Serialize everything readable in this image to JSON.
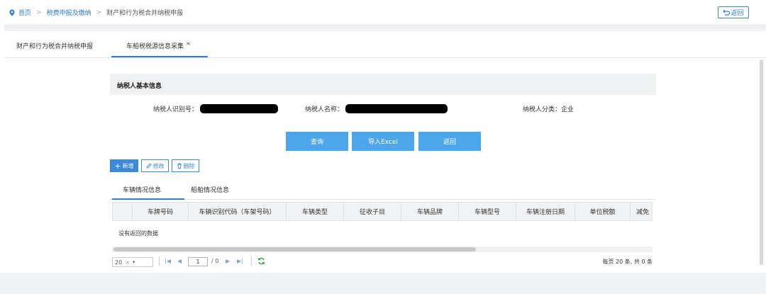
{
  "breadcrumb": {
    "home": "首页",
    "level1": "税费申报及缴纳",
    "current": "财产和行为税合并纳税申报"
  },
  "back_top_label": "返回",
  "tabs": [
    {
      "label": "财产和行为税合并纳税申报"
    },
    {
      "label": "车船税税源信息采集",
      "close": "×"
    }
  ],
  "section_title": "纳税人基本信息",
  "fields": {
    "taxpayer_id_label": "纳税人识别号：",
    "taxpayer_name_label": "纳税人名称：",
    "taxpayer_type_label": "纳税人分类：",
    "taxpayer_type_value": "企业"
  },
  "buttons": {
    "query": "查询",
    "import_excel": "导入Excel",
    "back": "返回"
  },
  "toolbar": {
    "add": "新增",
    "edit": "修改",
    "delete": "删除"
  },
  "subtabs": [
    "车辆情况信息",
    "船舶情况信息"
  ],
  "grid": {
    "columns": [
      "车牌号码",
      "车辆识别代码（车架号码）",
      "车辆类型",
      "征收子目",
      "车辆品牌",
      "车辆型号",
      "车辆注册日期",
      "单位税额",
      "减免"
    ],
    "empty_text": "没有返回的数据"
  },
  "pager": {
    "page_size": "20",
    "current_page": "1",
    "total_pages": "/ 0",
    "summary": "每页 20 条, 共 0 条"
  },
  "colors": {
    "accent": "#2f7fd1",
    "button": "#4ea6ea"
  }
}
